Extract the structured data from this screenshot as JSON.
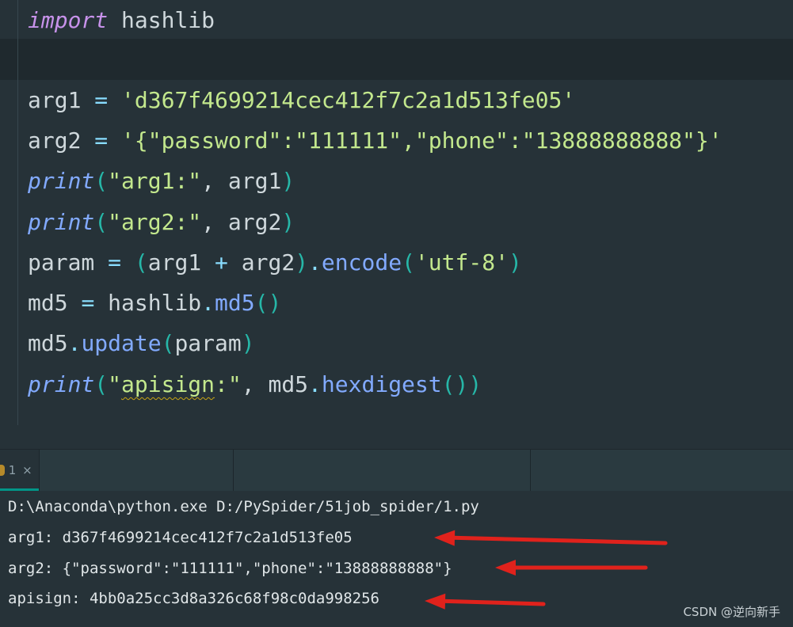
{
  "code_lines": [
    [
      {
        "t": "import",
        "c": "kw-italic"
      },
      {
        "t": " hashlib",
        "c": "id"
      }
    ],
    [],
    [
      {
        "t": "arg1 ",
        "c": "id"
      },
      {
        "t": "=",
        "c": "op"
      },
      {
        "t": " ",
        "c": "id"
      },
      {
        "t": "'d367f4699214cec412f7c2a1d513fe05'",
        "c": "str"
      }
    ],
    [
      {
        "t": "arg2 ",
        "c": "id"
      },
      {
        "t": "=",
        "c": "op"
      },
      {
        "t": " ",
        "c": "id"
      },
      {
        "t": "'{\"password\":\"111111\",\"phone\":\"13888888888\"}'",
        "c": "str"
      }
    ],
    [
      {
        "t": "print",
        "c": "builtin"
      },
      {
        "t": "(",
        "c": "paren"
      },
      {
        "t": "\"arg1:\"",
        "c": "str"
      },
      {
        "t": ", arg1",
        "c": "id"
      },
      {
        "t": ")",
        "c": "paren"
      }
    ],
    [
      {
        "t": "print",
        "c": "builtin"
      },
      {
        "t": "(",
        "c": "paren"
      },
      {
        "t": "\"arg2:\"",
        "c": "str"
      },
      {
        "t": ", arg2",
        "c": "id"
      },
      {
        "t": ")",
        "c": "paren"
      }
    ],
    [
      {
        "t": "param ",
        "c": "id"
      },
      {
        "t": "=",
        "c": "op"
      },
      {
        "t": " ",
        "c": "id"
      },
      {
        "t": "(",
        "c": "paren"
      },
      {
        "t": "arg1 ",
        "c": "id"
      },
      {
        "t": "+",
        "c": "op"
      },
      {
        "t": " arg2",
        "c": "id"
      },
      {
        "t": ")",
        "c": "paren"
      },
      {
        "t": ".",
        "c": "op"
      },
      {
        "t": "encode",
        "c": "method"
      },
      {
        "t": "(",
        "c": "paren"
      },
      {
        "t": "'utf-8'",
        "c": "str"
      },
      {
        "t": ")",
        "c": "paren"
      }
    ],
    [
      {
        "t": "md5 ",
        "c": "id"
      },
      {
        "t": "=",
        "c": "op"
      },
      {
        "t": " hashlib",
        "c": "id"
      },
      {
        "t": ".",
        "c": "op"
      },
      {
        "t": "md5",
        "c": "method"
      },
      {
        "t": "()",
        "c": "paren"
      }
    ],
    [
      {
        "t": "md5",
        "c": "id"
      },
      {
        "t": ".",
        "c": "op"
      },
      {
        "t": "update",
        "c": "method"
      },
      {
        "t": "(",
        "c": "paren"
      },
      {
        "t": "param",
        "c": "id"
      },
      {
        "t": ")",
        "c": "paren"
      }
    ],
    [
      {
        "t": "print",
        "c": "builtin"
      },
      {
        "t": "(",
        "c": "paren"
      },
      {
        "t": "\"",
        "c": "str"
      },
      {
        "t": "apisign",
        "c": "str squiggle"
      },
      {
        "t": ":\"",
        "c": "str"
      },
      {
        "t": ", md5",
        "c": "id"
      },
      {
        "t": ".",
        "c": "op"
      },
      {
        "t": "hexdigest",
        "c": "method"
      },
      {
        "t": "())",
        "c": "paren"
      }
    ]
  ],
  "run_tab": {
    "label": "1",
    "close_glyph": "×"
  },
  "console": {
    "lines": [
      "D:\\Anaconda\\python.exe D:/PySpider/51job_spider/1.py",
      "arg1: d367f4699214cec412f7c2a1d513fe05",
      "arg2: {\"password\":\"111111\",\"phone\":\"13888888888\"}",
      "apisign: 4bb0a25cc3d8a326c68f98c0da998256"
    ]
  },
  "annotation_color": "#e0221c",
  "watermark": "CSDN @逆向新手"
}
